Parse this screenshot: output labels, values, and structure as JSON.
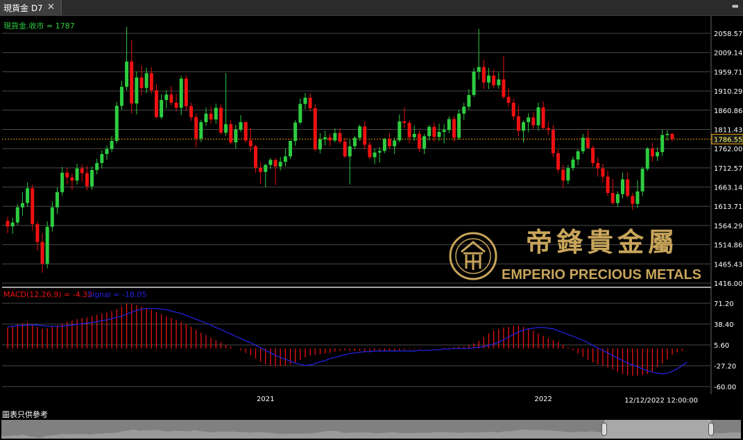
{
  "tab": {
    "title": "現貨金 D7",
    "close_glyph": "✕"
  },
  "footer": {
    "disclaimer": "圖表只供參考"
  },
  "navigator": {
    "window_start": 0.815,
    "window_end": 0.96
  },
  "watermark": {
    "brand_cn": "帝鋒貴金屬",
    "brand_en": "EMPERIO PRECIOUS METALS"
  },
  "colors": {
    "up": "#2ecc40",
    "down": "#ee1111",
    "signal": "#2222dd",
    "grid": "#4a4a4a",
    "last": "#e8a000",
    "axis_text": "#ffffff"
  },
  "chart_data": [
    {
      "type": "candlestick",
      "series_label": "現貨金.收市 = 1787",
      "last_value": 1786.55,
      "last_label": "1786.55",
      "y_ticks": [
        "2058.57",
        "2009.14",
        "1959.71",
        "1910.29",
        "1860.86",
        "1811.43",
        "1762.00",
        "1712.57",
        "1663.14",
        "1613.71",
        "1564.29",
        "1514.86",
        "1465.43",
        "1416.00"
      ],
      "ylim": [
        1416.0,
        2058.57
      ],
      "x_labels": [
        {
          "label": "2021",
          "index": 52
        },
        {
          "label": "2022",
          "index": 108
        }
      ],
      "date_label": "12/12/2022 12:00:00",
      "ohlc": [
        [
          1576,
          1587,
          1545,
          1562
        ],
        [
          1562,
          1585,
          1543,
          1572
        ],
        [
          1572,
          1620,
          1566,
          1611
        ],
        [
          1611,
          1650,
          1590,
          1622
        ],
        [
          1622,
          1675,
          1612,
          1660
        ],
        [
          1660,
          1669,
          1552,
          1568
        ],
        [
          1568,
          1575,
          1500,
          1522
        ],
        [
          1522,
          1545,
          1443,
          1466
        ],
        [
          1466,
          1575,
          1454,
          1561
        ],
        [
          1561,
          1626,
          1549,
          1611
        ],
        [
          1611,
          1662,
          1594,
          1650
        ],
        [
          1650,
          1715,
          1641,
          1700
        ],
        [
          1700,
          1712,
          1670,
          1688
        ],
        [
          1688,
          1698,
          1655,
          1680
        ],
        [
          1680,
          1723,
          1670,
          1711
        ],
        [
          1711,
          1722,
          1678,
          1699
        ],
        [
          1699,
          1718,
          1655,
          1665
        ],
        [
          1665,
          1716,
          1656,
          1707
        ],
        [
          1707,
          1736,
          1696,
          1725
        ],
        [
          1725,
          1758,
          1711,
          1748
        ],
        [
          1748,
          1770,
          1733,
          1761
        ],
        [
          1761,
          1795,
          1753,
          1782
        ],
        [
          1782,
          1882,
          1775,
          1872
        ],
        [
          1872,
          1936,
          1862,
          1921
        ],
        [
          1921,
          2075,
          1912,
          1986
        ],
        [
          1986,
          2041,
          1852,
          1878
        ],
        [
          1878,
          1960,
          1850,
          1945
        ],
        [
          1945,
          1975,
          1900,
          1918
        ],
        [
          1918,
          1970,
          1905,
          1956
        ],
        [
          1956,
          1972,
          1903,
          1912
        ],
        [
          1912,
          1928,
          1840,
          1843
        ],
        [
          1843,
          1902,
          1838,
          1887
        ],
        [
          1887,
          1912,
          1865,
          1901
        ],
        [
          1901,
          1923,
          1873,
          1880
        ],
        [
          1880,
          1903,
          1858,
          1867
        ],
        [
          1867,
          1950,
          1848,
          1942
        ],
        [
          1942,
          1950,
          1859,
          1871
        ],
        [
          1871,
          1880,
          1833,
          1843
        ],
        [
          1843,
          1852,
          1765,
          1788
        ],
        [
          1788,
          1836,
          1779,
          1830
        ],
        [
          1830,
          1868,
          1820,
          1852
        ],
        [
          1852,
          1870,
          1826,
          1837
        ],
        [
          1837,
          1878,
          1826,
          1867
        ],
        [
          1867,
          1876,
          1799,
          1803
        ],
        [
          1803,
          1956,
          1795,
          1825
        ],
        [
          1825,
          1836,
          1773,
          1778
        ],
        [
          1778,
          1823,
          1762,
          1811
        ],
        [
          1811,
          1848,
          1805,
          1830
        ],
        [
          1830,
          1832,
          1778,
          1783
        ],
        [
          1783,
          1815,
          1755,
          1768
        ],
        [
          1768,
          1772,
          1700,
          1713
        ],
        [
          1713,
          1728,
          1670,
          1702
        ],
        [
          1702,
          1723,
          1663,
          1720
        ],
        [
          1720,
          1738,
          1710,
          1733
        ],
        [
          1733,
          1738,
          1668,
          1716
        ],
        [
          1716,
          1740,
          1706,
          1728
        ],
        [
          1728,
          1762,
          1716,
          1742
        ],
        [
          1742,
          1782,
          1735,
          1782
        ],
        [
          1782,
          1835,
          1770,
          1829
        ],
        [
          1829,
          1891,
          1824,
          1877
        ],
        [
          1877,
          1905,
          1864,
          1893
        ],
        [
          1893,
          1904,
          1858,
          1866
        ],
        [
          1866,
          1876,
          1755,
          1760
        ],
        [
          1760,
          1802,
          1750,
          1786
        ],
        [
          1786,
          1808,
          1770,
          1791
        ],
        [
          1791,
          1800,
          1768,
          1783
        ],
        [
          1783,
          1814,
          1778,
          1802
        ],
        [
          1802,
          1815,
          1774,
          1780
        ],
        [
          1780,
          1790,
          1738,
          1742
        ],
        [
          1742,
          1784,
          1670,
          1768
        ],
        [
          1768,
          1794,
          1760,
          1790
        ],
        [
          1790,
          1824,
          1782,
          1819
        ],
        [
          1819,
          1832,
          1760,
          1772
        ],
        [
          1772,
          1782,
          1735,
          1740
        ],
        [
          1740,
          1762,
          1722,
          1752
        ],
        [
          1752,
          1766,
          1726,
          1756
        ],
        [
          1756,
          1790,
          1750,
          1786
        ],
        [
          1786,
          1802,
          1760,
          1768
        ],
        [
          1768,
          1790,
          1748,
          1783
        ],
        [
          1783,
          1850,
          1778,
          1832
        ],
        [
          1832,
          1868,
          1815,
          1828
        ],
        [
          1828,
          1834,
          1776,
          1791
        ],
        [
          1791,
          1822,
          1782,
          1800
        ],
        [
          1800,
          1808,
          1754,
          1762
        ],
        [
          1762,
          1800,
          1748,
          1794
        ],
        [
          1794,
          1823,
          1783,
          1818
        ],
        [
          1818,
          1830,
          1780,
          1792
        ],
        [
          1792,
          1826,
          1782,
          1805
        ],
        [
          1805,
          1825,
          1775,
          1810
        ],
        [
          1810,
          1845,
          1802,
          1838
        ],
        [
          1838,
          1846,
          1780,
          1790
        ],
        [
          1790,
          1862,
          1784,
          1852
        ],
        [
          1852,
          1880,
          1835,
          1870
        ],
        [
          1870,
          1915,
          1862,
          1900
        ],
        [
          1900,
          1970,
          1895,
          1960
        ],
        [
          1960,
          2070,
          1940,
          1972
        ],
        [
          1972,
          1990,
          1915,
          1932
        ],
        [
          1932,
          1970,
          1915,
          1950
        ],
        [
          1950,
          1965,
          1918,
          1925
        ],
        [
          1925,
          1958,
          1916,
          1940
        ],
        [
          1940,
          2000,
          1890,
          1895
        ],
        [
          1895,
          1918,
          1870,
          1880
        ],
        [
          1880,
          1890,
          1836,
          1845
        ],
        [
          1845,
          1872,
          1793,
          1808
        ],
        [
          1808,
          1834,
          1778,
          1830
        ],
        [
          1830,
          1853,
          1804,
          1842
        ],
        [
          1842,
          1856,
          1813,
          1822
        ],
        [
          1822,
          1880,
          1808,
          1868
        ],
        [
          1868,
          1883,
          1812,
          1815
        ],
        [
          1815,
          1830,
          1796,
          1810
        ],
        [
          1810,
          1823,
          1740,
          1750
        ],
        [
          1750,
          1760,
          1700,
          1708
        ],
        [
          1708,
          1720,
          1660,
          1680
        ],
        [
          1680,
          1720,
          1670,
          1712
        ],
        [
          1712,
          1742,
          1705,
          1734
        ],
        [
          1734,
          1760,
          1720,
          1755
        ],
        [
          1755,
          1800,
          1748,
          1790
        ],
        [
          1790,
          1810,
          1760,
          1764
        ],
        [
          1764,
          1770,
          1716,
          1725
        ],
        [
          1725,
          1740,
          1690,
          1711
        ],
        [
          1711,
          1723,
          1675,
          1690
        ],
        [
          1690,
          1706,
          1640,
          1648
        ],
        [
          1648,
          1684,
          1618,
          1622
        ],
        [
          1622,
          1652,
          1612,
          1645
        ],
        [
          1645,
          1700,
          1634,
          1683
        ],
        [
          1683,
          1701,
          1636,
          1640
        ],
        [
          1640,
          1648,
          1604,
          1620
        ],
        [
          1620,
          1680,
          1610,
          1652
        ],
        [
          1652,
          1715,
          1640,
          1710
        ],
        [
          1710,
          1766,
          1704,
          1762
        ],
        [
          1762,
          1777,
          1728,
          1742
        ],
        [
          1742,
          1765,
          1730,
          1753
        ],
        [
          1753,
          1810,
          1743,
          1797
        ],
        [
          1797,
          1810,
          1783,
          1800
        ],
        [
          1800,
          1802,
          1780,
          1787
        ]
      ]
    },
    {
      "type": "macd",
      "label": "MACD(12,26,9) = -4.32",
      "signal_label": "Signal = -18.05",
      "y_ticks": [
        "71.20",
        "38.40",
        "5.60",
        "-27.20",
        "-60.00"
      ],
      "ylim": [
        -60,
        71.2
      ],
      "macd": [
        33,
        35,
        38,
        40,
        41,
        38,
        34,
        31,
        32,
        34,
        36,
        39,
        42,
        44,
        46,
        48,
        49,
        51,
        53,
        55,
        57,
        59,
        62,
        66,
        71,
        70,
        68,
        66,
        64,
        61,
        57,
        54,
        51,
        48,
        45,
        42,
        38,
        34,
        29,
        25,
        21,
        17,
        13,
        10,
        6,
        3,
        0,
        -3,
        -7,
        -11,
        -16,
        -21,
        -25,
        -27,
        -28,
        -28,
        -27,
        -25,
        -22,
        -18,
        -14,
        -11,
        -10,
        -9,
        -8,
        -7,
        -5,
        -4,
        -3,
        -4,
        -4,
        -4,
        -4,
        -4,
        -4,
        -4,
        -4,
        -4,
        -4,
        -3,
        -2,
        -1,
        -1,
        -1,
        0,
        0,
        0,
        0,
        1,
        1,
        2,
        3,
        3,
        5,
        8,
        12,
        18,
        24,
        28,
        31,
        33,
        34,
        35,
        36,
        34,
        32,
        28,
        24,
        20,
        16,
        13,
        10,
        6,
        2,
        -3,
        -8,
        -13,
        -18,
        -22,
        -25,
        -27,
        -30,
        -33,
        -37,
        -40,
        -42,
        -43,
        -43,
        -42,
        -40,
        -36,
        -30,
        -24,
        -17,
        -10,
        -6,
        -4
      ],
      "signal": [
        34,
        35,
        36,
        36,
        37,
        37,
        37,
        36,
        35,
        35,
        35,
        35,
        36,
        37,
        38,
        39,
        40,
        41,
        42,
        44,
        45,
        47,
        49,
        51,
        54,
        57,
        60,
        62,
        63,
        63,
        63,
        62,
        61,
        59,
        57,
        55,
        52,
        49,
        46,
        43,
        40,
        37,
        33,
        30,
        26,
        23,
        19,
        16,
        12,
        9,
        5,
        1,
        -3,
        -7,
        -11,
        -14,
        -17,
        -20,
        -23,
        -25,
        -27,
        -26,
        -24,
        -21,
        -19,
        -16,
        -14,
        -12,
        -10,
        -8,
        -7,
        -6,
        -5,
        -5,
        -4,
        -4,
        -4,
        -4,
        -4,
        -4,
        -4,
        -4,
        -4,
        -3,
        -3,
        -3,
        -2,
        -2,
        -1,
        -1,
        0,
        0,
        0,
        0,
        1,
        2,
        3,
        5,
        7,
        10,
        14,
        18,
        22,
        26,
        29,
        31,
        32,
        33,
        33,
        32,
        31,
        28,
        25,
        22,
        19,
        16,
        13,
        9,
        5,
        1,
        -3,
        -7,
        -11,
        -15,
        -19,
        -23,
        -26,
        -29,
        -32,
        -35,
        -37,
        -39,
        -40,
        -39,
        -36,
        -32,
        -27,
        -22
      ]
    }
  ]
}
